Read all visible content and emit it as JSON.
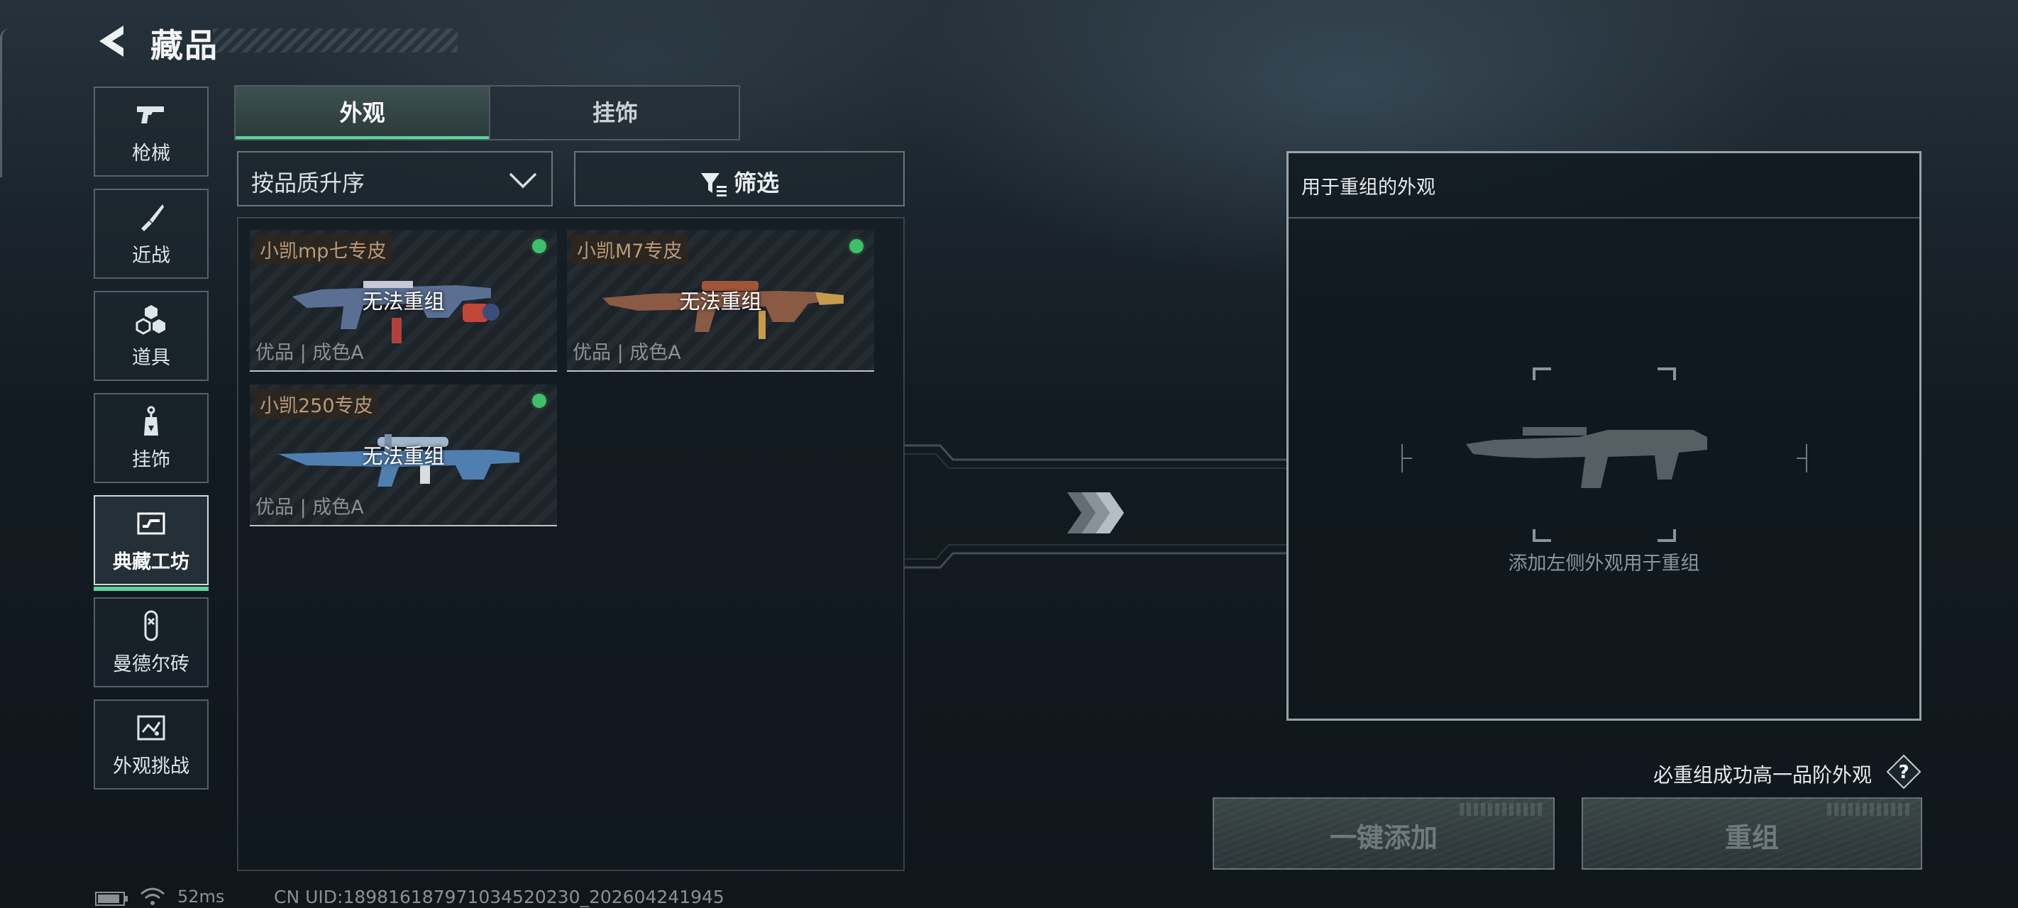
{
  "header": {
    "title": "藏品",
    "back_icon": "back-arrow-icon"
  },
  "sidebar": {
    "items": [
      {
        "label": "枪械",
        "icon": "pistol-icon",
        "active": false
      },
      {
        "label": "近战",
        "icon": "knife-icon",
        "active": false
      },
      {
        "label": "道具",
        "icon": "hexagon-cluster-icon",
        "active": false
      },
      {
        "label": "挂饰",
        "icon": "charm-tag-icon",
        "active": false
      },
      {
        "label": "典藏工坊",
        "icon": "workshop-icon",
        "active": true
      },
      {
        "label": "曼德尔砖",
        "icon": "mandel-brick-icon",
        "active": false
      },
      {
        "label": "外观挑战",
        "icon": "challenge-map-icon",
        "active": false
      }
    ],
    "accent_color": "#5fd39a"
  },
  "tabs": [
    {
      "label": "外观",
      "active": true
    },
    {
      "label": "挂饰",
      "active": false
    }
  ],
  "sort": {
    "selected": "按品质升序",
    "icon": "chevron-down-icon"
  },
  "filter": {
    "label": "筛选",
    "icon": "funnel-icon"
  },
  "skins": [
    {
      "name": "小凯mp七专皮",
      "status": "无法重组",
      "meta": "优品 | 成色A",
      "gun": "smg-skin-icon"
    },
    {
      "name": "小凯M7专皮",
      "status": "无法重组",
      "meta": "优品 | 成色A",
      "gun": "rifle-skin-icon"
    },
    {
      "name": "小凯250专皮",
      "status": "无法重组",
      "meta": "优品 | 成色A",
      "gun": "sniper-skin-icon"
    }
  ],
  "target": {
    "title": "用于重组的外观",
    "hint": "添加左侧外观用于重组",
    "placeholder_icon": "rifle-silhouette-icon"
  },
  "guarantee": {
    "text": "必重组成功高一品阶外观",
    "help_icon": "question-icon"
  },
  "buttons": {
    "add_all": "一键添加",
    "reroll": "重组"
  },
  "status_bar": {
    "ping": "52ms",
    "uid": "CN UID:189816187971034520230_202604241945",
    "battery_icon": "battery-icon",
    "wifi_icon": "wifi-icon"
  },
  "colors": {
    "owned_dot": "#3cc06a",
    "skin_name": "#b89a78"
  }
}
